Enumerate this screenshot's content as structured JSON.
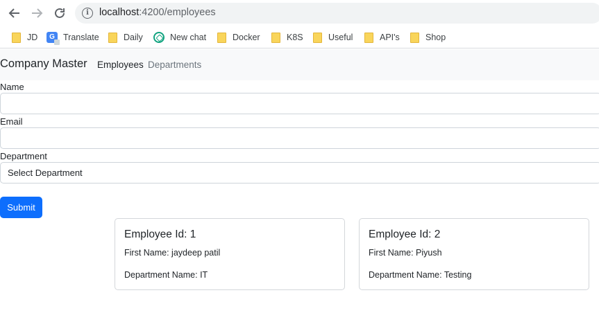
{
  "browser": {
    "url_host": "localhost",
    "url_path": ":4200/employees",
    "bookmarks": [
      {
        "label": "JD",
        "icon": "folder-icon"
      },
      {
        "label": "Translate",
        "icon": "google-translate-icon"
      },
      {
        "label": "Daily",
        "icon": "folder-icon"
      },
      {
        "label": "New chat",
        "icon": "chatgpt-icon"
      },
      {
        "label": "Docker",
        "icon": "folder-icon"
      },
      {
        "label": "K8S",
        "icon": "folder-icon"
      },
      {
        "label": "Useful",
        "icon": "folder-icon"
      },
      {
        "label": "API's",
        "icon": "folder-icon"
      },
      {
        "label": "Shop",
        "icon": "folder-icon"
      }
    ]
  },
  "navbar": {
    "brand": "Company Master",
    "links": [
      {
        "label": "Employees",
        "active": true
      },
      {
        "label": "Departments",
        "active": false
      }
    ]
  },
  "form": {
    "name_label": "Name",
    "name_value": "",
    "email_label": "Email",
    "email_value": "",
    "department_label": "Department",
    "department_selected": "Select Department",
    "submit_label": "Submit"
  },
  "employees": [
    {
      "title": "Employee Id: 1",
      "first_name": "First Name: jaydeep patil",
      "department": "Department Name: IT"
    },
    {
      "title": "Employee Id: 2",
      "first_name": "First Name: Piyush",
      "department": "Department Name: Testing"
    }
  ],
  "colors": {
    "primary": "#0d6efd",
    "navbar_bg": "#f8f9fa",
    "folder": "#f9d55b"
  }
}
